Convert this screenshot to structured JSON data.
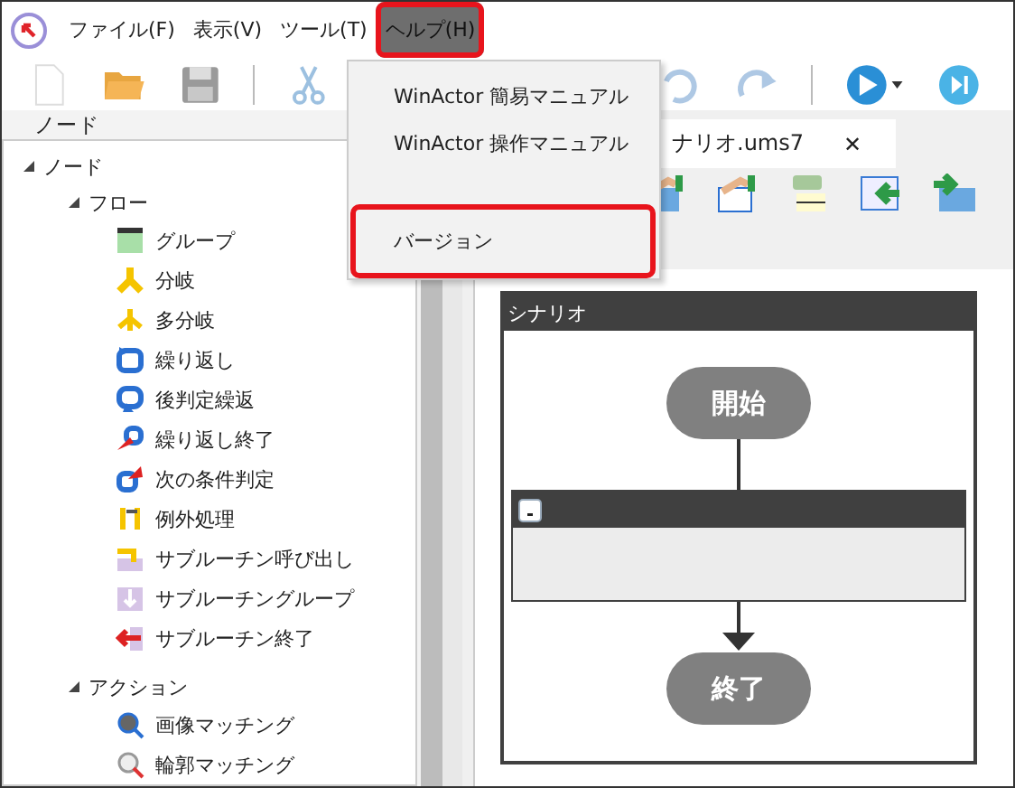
{
  "menubar": {
    "items": [
      {
        "label": "ファイル(F)",
        "selected": false,
        "highlighted": false
      },
      {
        "label": "表示(V)",
        "selected": false,
        "highlighted": false
      },
      {
        "label": "ツール(T)",
        "selected": false,
        "highlighted": false
      },
      {
        "label": "ヘルプ(H)",
        "selected": true,
        "highlighted": true
      }
    ]
  },
  "help_menu": {
    "items": [
      {
        "kind": "item",
        "label": "WinActor 簡易マニュアル",
        "highlighted": false
      },
      {
        "kind": "item",
        "label": "WinActor 操作マニュアル",
        "highlighted": false
      },
      {
        "kind": "separator"
      },
      {
        "kind": "item",
        "label": "バージョン",
        "highlighted": true
      }
    ]
  },
  "node_panel": {
    "title": "ノード",
    "tree": [
      {
        "label": "ノード",
        "expanded": true,
        "children": [
          {
            "label": "フロー",
            "expanded": true,
            "children": [
              {
                "label": "グループ"
              },
              {
                "label": "分岐"
              },
              {
                "label": "多分岐"
              },
              {
                "label": "繰り返し"
              },
              {
                "label": "後判定繰返"
              },
              {
                "label": "繰り返し終了"
              },
              {
                "label": "次の条件判定"
              },
              {
                "label": "例外処理"
              },
              {
                "label": "サブルーチン呼び出し"
              },
              {
                "label": "サブルーチングループ"
              },
              {
                "label": "サブルーチン終了"
              }
            ]
          },
          {
            "label": "アクション",
            "expanded": true,
            "children": [
              {
                "label": "画像マッチング"
              },
              {
                "label": "輪郭マッチング"
              }
            ]
          }
        ]
      }
    ]
  },
  "editor_tab": {
    "label": "ナリオ.ums7",
    "close": "✕"
  },
  "scenario": {
    "title": "シナリオ",
    "start": "開始",
    "end": "終了"
  }
}
